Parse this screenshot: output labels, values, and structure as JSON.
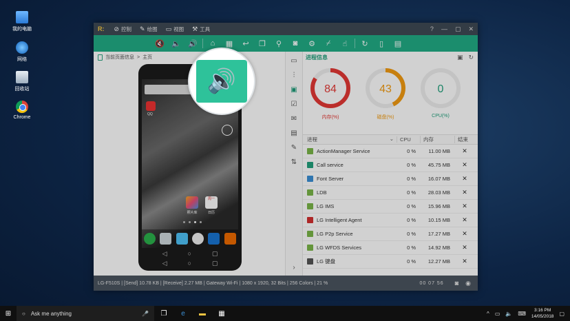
{
  "desktop": {
    "icons": [
      {
        "label": "我的电脑",
        "icon": "computer-icon"
      },
      {
        "label": "网络",
        "icon": "network-icon"
      },
      {
        "label": "回收站",
        "icon": "recycle-bin-icon"
      },
      {
        "label": "Chrome",
        "icon": "chrome-icon"
      }
    ]
  },
  "window": {
    "logo": "R:",
    "menu": [
      {
        "label": "控制",
        "glyph": "⊘"
      },
      {
        "label": "绘图",
        "glyph": "✎"
      },
      {
        "label": "视图",
        "glyph": "▭"
      },
      {
        "label": "工具",
        "glyph": "⚒"
      }
    ],
    "controls": [
      "?",
      "—",
      "▢",
      "✕"
    ]
  },
  "toolbar": {
    "buttons": [
      {
        "name": "mute-icon",
        "glyph": "🔇"
      },
      {
        "name": "volume-down-icon",
        "glyph": "🔈"
      },
      {
        "name": "volume-up-icon",
        "glyph": "🔊"
      },
      {
        "name": "home-icon",
        "glyph": "⌂"
      },
      {
        "name": "apps-icon",
        "glyph": "▦"
      },
      {
        "name": "back-icon",
        "glyph": "↩"
      },
      {
        "name": "recent-apps-icon",
        "glyph": "❐"
      },
      {
        "name": "search-icon",
        "glyph": "⚲"
      },
      {
        "name": "camera-icon",
        "glyph": "◙"
      },
      {
        "name": "settings-icon",
        "glyph": "⚙"
      },
      {
        "name": "clean-icon",
        "glyph": "⌿"
      },
      {
        "name": "touch-icon",
        "glyph": "☝"
      },
      {
        "name": "rotate-icon",
        "glyph": "↻"
      },
      {
        "name": "phone-icon",
        "glyph": "▯"
      },
      {
        "name": "phone-info-icon",
        "glyph": "▤"
      }
    ]
  },
  "left_panel": {
    "breadcrumb": [
      "当前页面信息",
      "主页"
    ],
    "phone": {
      "qq_label": "QQ",
      "apps": [
        "照片库",
        "日历"
      ],
      "calendar_text": "周一"
    }
  },
  "magnifier": {
    "glyph": "🔊"
  },
  "side_tabs": [
    {
      "name": "storage-tab-icon",
      "glyph": "▭"
    },
    {
      "name": "equalizer-tab-icon",
      "glyph": "⫶"
    },
    {
      "name": "chip-tab-icon",
      "glyph": "▣"
    },
    {
      "name": "checklist-tab-icon",
      "glyph": "☑"
    },
    {
      "name": "messages-tab-icon",
      "glyph": "✉"
    },
    {
      "name": "document-tab-icon",
      "glyph": "▤"
    },
    {
      "name": "edit-tab-icon",
      "glyph": "✎"
    },
    {
      "name": "transfer-tab-icon",
      "glyph": "⇅"
    }
  ],
  "right_panel": {
    "title": "进程信息",
    "gauges": [
      {
        "label": "内存(%)",
        "value": 84,
        "color": "#e53935"
      },
      {
        "label": "磁盘(%)",
        "value": 43,
        "color": "#f39c12"
      },
      {
        "label": "CPU(%)",
        "value": 0,
        "color": "#23a17d"
      }
    ],
    "columns": [
      "进程",
      "CPU",
      "内存",
      "结束"
    ],
    "processes": [
      {
        "name": "ActionManager Service",
        "cpu": "0 %",
        "mem": "11.00 MB",
        "color": "#7ab648"
      },
      {
        "name": "Call service",
        "cpu": "0 %",
        "mem": "45.75 MB",
        "color": "#23a17d"
      },
      {
        "name": "Font Server",
        "cpu": "0 %",
        "mem": "16.07 MB",
        "color": "#3b8fd6"
      },
      {
        "name": "LDB",
        "cpu": "0 %",
        "mem": "28.03 MB",
        "color": "#7ab648"
      },
      {
        "name": "LG IMS",
        "cpu": "0 %",
        "mem": "15.96 MB",
        "color": "#7ab648"
      },
      {
        "name": "LG Intelligent Agent",
        "cpu": "0 %",
        "mem": "10.15 MB",
        "color": "#d32f2f"
      },
      {
        "name": "LG P2p Service",
        "cpu": "0 %",
        "mem": "17.27 MB",
        "color": "#7ab648"
      },
      {
        "name": "LG WFDS Services",
        "cpu": "0 %",
        "mem": "14.92 MB",
        "color": "#7ab648"
      },
      {
        "name": "LG 键盘",
        "cpu": "0 %",
        "mem": "12.27 MB",
        "color": "#555555"
      }
    ]
  },
  "status_bar": {
    "text": "LG-F510S | [Send] 10.78 KB | [Receive] 2.27 MB | Gateway Wi-Fi | 1080 x 1920, 32 Bits | 256 Colors | 21 %",
    "timer": "00 07 56"
  },
  "taskbar": {
    "search_placeholder": "Ask me anything",
    "time": "3:16 PM",
    "date": "14/05/2018"
  }
}
